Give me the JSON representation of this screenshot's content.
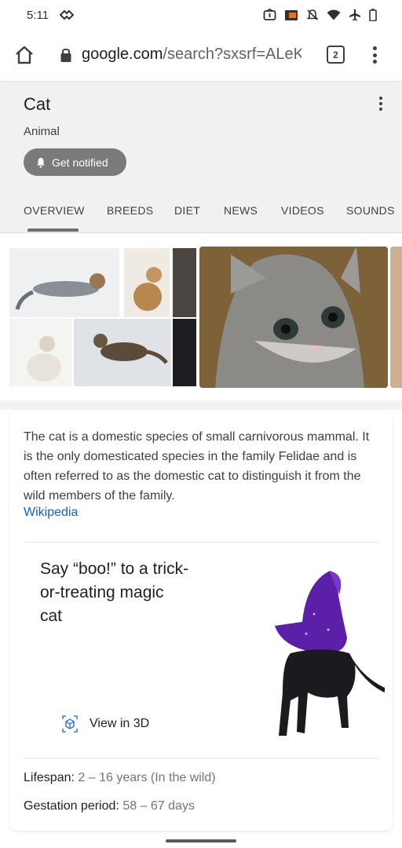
{
  "status_bar": {
    "time": "5:11",
    "icons": [
      "data-saver-icon",
      "alarm-icon",
      "cast-icon",
      "dnd-icon",
      "wifi-icon",
      "airplane-icon",
      "battery-icon"
    ]
  },
  "browser": {
    "url_host": "google.com",
    "url_path": "/search?sxsrf=ALeK",
    "tab_count": "2"
  },
  "entity": {
    "title": "Cat",
    "subtitle": "Animal",
    "notify_label": "Get notified",
    "tabs": [
      "OVERVIEW",
      "BREEDS",
      "DIET",
      "NEWS",
      "VIDEOS",
      "SOUNDS"
    ],
    "active_tab": "OVERVIEW"
  },
  "description": {
    "text": "The cat is a domestic species of small carnivorous mammal. It is the only domesticated species in the family Felidae and is often referred to as the domestic cat to distinguish it from the wild members of the family.",
    "source": "Wikipedia"
  },
  "promo": {
    "text": "Say “boo!” to a trick-or-treating magic cat",
    "view_3d_label": "View in 3D"
  },
  "facts": [
    {
      "label": "Lifespan:",
      "value": "2 – 16 years (In the wild)"
    },
    {
      "label": "Gestation period:",
      "value": "58 – 67 days"
    }
  ],
  "colors": {
    "accent_link": "#1a5fb4",
    "header_bg": "#f1f1f1",
    "notify_bg": "#7a7a7a"
  }
}
